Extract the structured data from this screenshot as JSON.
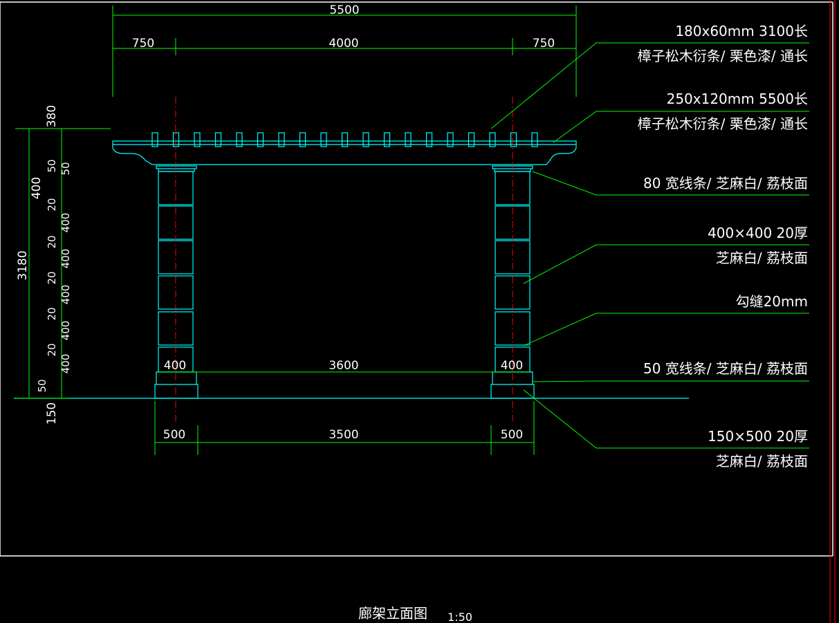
{
  "drawing": {
    "title": "廊架立面图",
    "scale": "1:50"
  },
  "dimensions": {
    "top_overall": "5500",
    "top_left": "750",
    "top_mid": "4000",
    "top_right": "750",
    "bottom_left": "500",
    "bottom_mid": "3500",
    "bottom_right": "500",
    "inner_left": "400",
    "inner_mid": "3600",
    "inner_right": "400",
    "left_total": "3180",
    "left_top_block": "400",
    "left_380": "380",
    "left_150": "150",
    "left_stack": [
      {
        "label": "50"
      },
      {
        "label": "50"
      },
      {
        "label": "20"
      },
      {
        "label": "400"
      },
      {
        "label": "20"
      },
      {
        "label": "400"
      },
      {
        "label": "20"
      },
      {
        "label": "400"
      },
      {
        "label": "20"
      },
      {
        "label": "400"
      },
      {
        "label": "20"
      },
      {
        "label": "400"
      },
      {
        "label": "50"
      }
    ]
  },
  "annotations": [
    {
      "line1": "180x60mm  3100长",
      "line2": "樟子松木衍条/ 栗色漆/ 通长"
    },
    {
      "line1": "250x120mm  5500长",
      "line2": "樟子松木衍条/ 栗色漆/ 通长"
    },
    {
      "line1": "80 宽线条/ 芝麻白/ 荔枝面",
      "line2": ""
    },
    {
      "line1": "400×400    20厚",
      "line2": "芝麻白/ 荔枝面"
    },
    {
      "line1": "勾缝20mm",
      "line2": ""
    },
    {
      "line1": "50 宽线条/ 芝麻白/ 荔枝面",
      "line2": ""
    },
    {
      "line1": "150×500    20厚",
      "line2": "芝麻白/ 荔枝面"
    }
  ],
  "colors": {
    "background": "#000000",
    "frame": "#ffffff",
    "dimension": "#00ff00",
    "structure": "#00ffff",
    "text": "#ffffff",
    "centerline": "#ff0000"
  }
}
